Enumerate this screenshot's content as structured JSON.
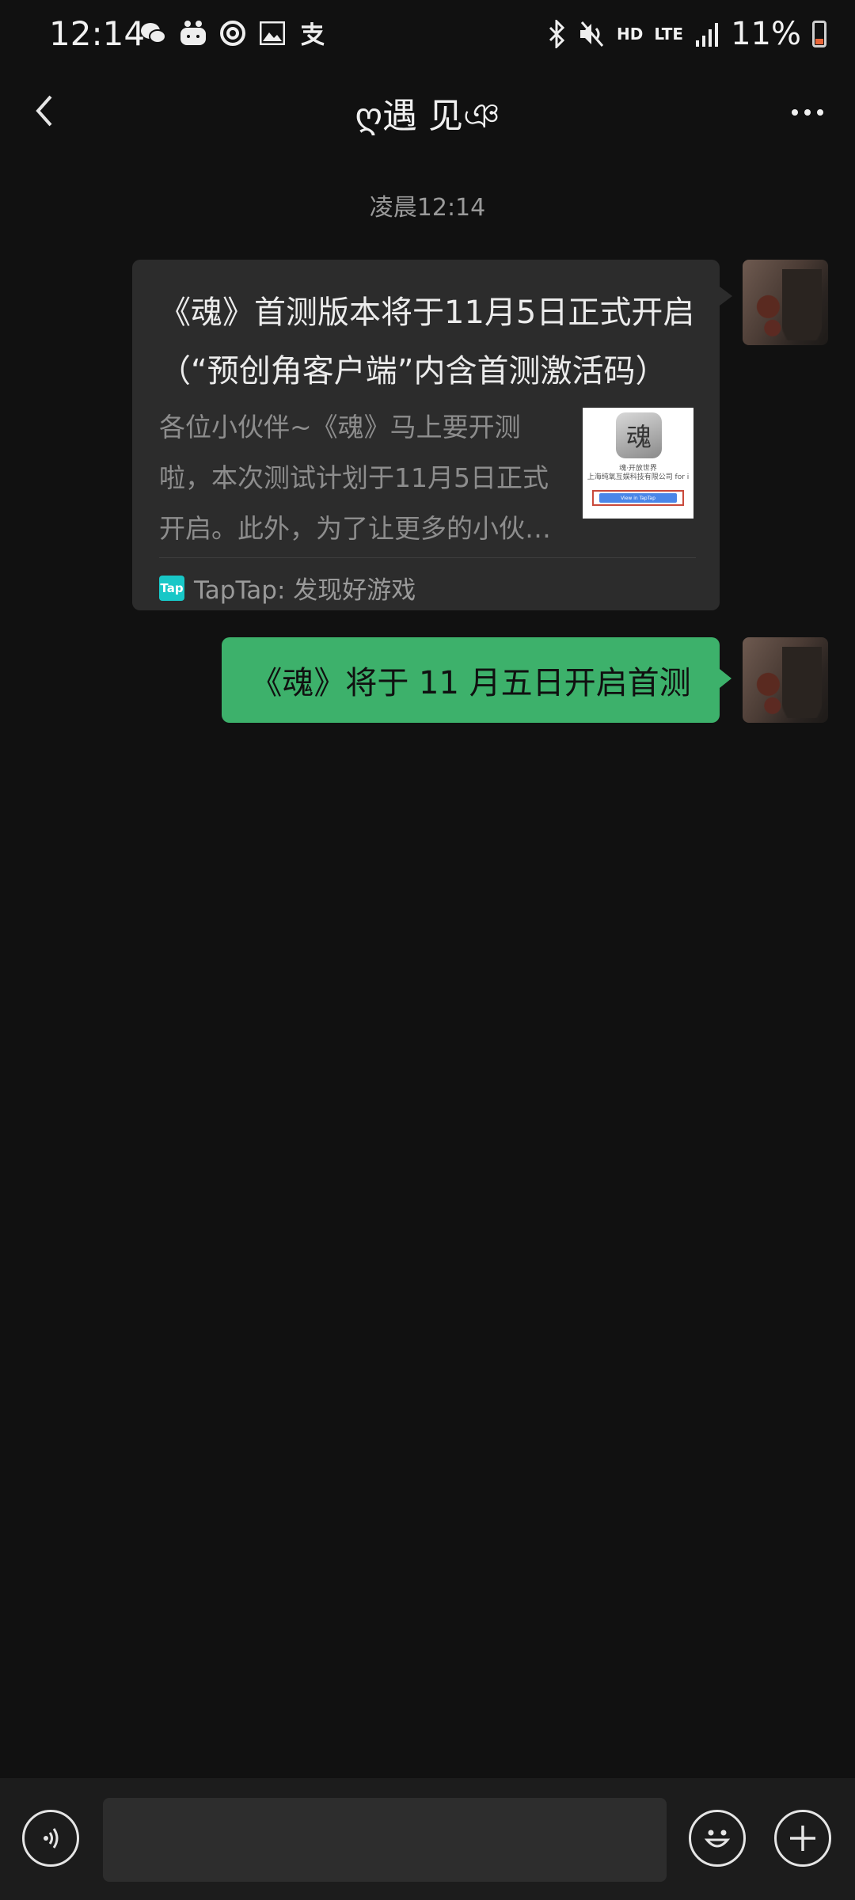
{
  "status_bar": {
    "time": "12:14",
    "left_icons": [
      "wechat-icon",
      "baby-monitor-icon",
      "swirl-app-icon",
      "gallery-icon",
      "alipay-icon"
    ],
    "hd_label": "HD",
    "lte_label": "LTE",
    "battery_percent": "11%"
  },
  "header": {
    "title": "ღ遇 见ঞ"
  },
  "chat": {
    "timestamp": "凌晨12:14",
    "card": {
      "title": "《魂》首测版本将于11月5日正式开启（“预创角客户端”内含首测激活码）",
      "description": "各位小伙伴~《魂》马上要开测啦，本次测试计划于11月5日正式开启。此外，为了让更多的小伙伴参与",
      "thumb_char": "魂",
      "thumb_caption": "魂·开放世界\n上海纯氧互娱科技有限公司 for i",
      "thumb_button": "View in TapTap",
      "source_icon_text": "Tap",
      "source_label": "TapTap: 发现好游戏"
    },
    "text_message": "《魂》将于 11 月五日开启首测"
  },
  "input_bar": {
    "placeholder": ""
  },
  "colors": {
    "background": "#111111",
    "bubble_green": "#3db16b",
    "card_bg": "#2c2c2c",
    "tap_brand": "#18c7c7"
  }
}
